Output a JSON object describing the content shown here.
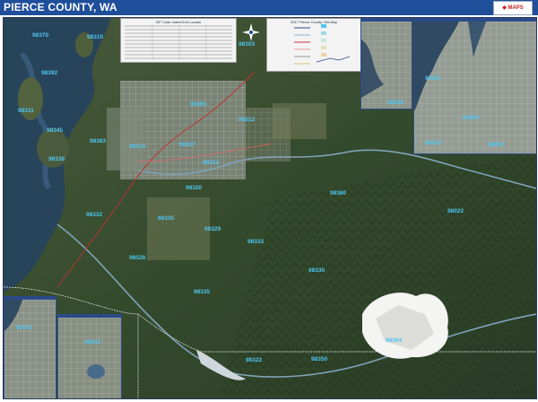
{
  "header": {
    "title": "PIERCE COUNTY, WA",
    "brand_color": "#1f4e9a"
  },
  "colors": {
    "water": "#27445a",
    "forest": "#2f4a2a",
    "urban": "#8f968e",
    "snow": "#f4f4f2",
    "zip_label": "#4ec6f0",
    "road": "#f0f0f0"
  },
  "panels": {
    "zip_index_title": "ZIP Code Index/Grid Locator",
    "legend_title": "2017 Pierce County, WA Map"
  },
  "zip_labels": [
    "98370",
    "98310",
    "98392",
    "98311",
    "98345",
    "98383",
    "98366",
    "98312",
    "98337",
    "98314",
    "98315",
    "98338",
    "98320",
    "98332",
    "98335",
    "98329",
    "98333",
    "98528",
    "98360",
    "98330",
    "98335",
    "98304",
    "98322",
    "98350",
    "98022",
    "98028",
    "98321",
    "98390",
    "98092",
    "98001",
    "98003",
    "98033",
    "98303"
  ],
  "icons": {
    "compass": "compass-rose-icon",
    "logo": "map-publisher-logo"
  }
}
